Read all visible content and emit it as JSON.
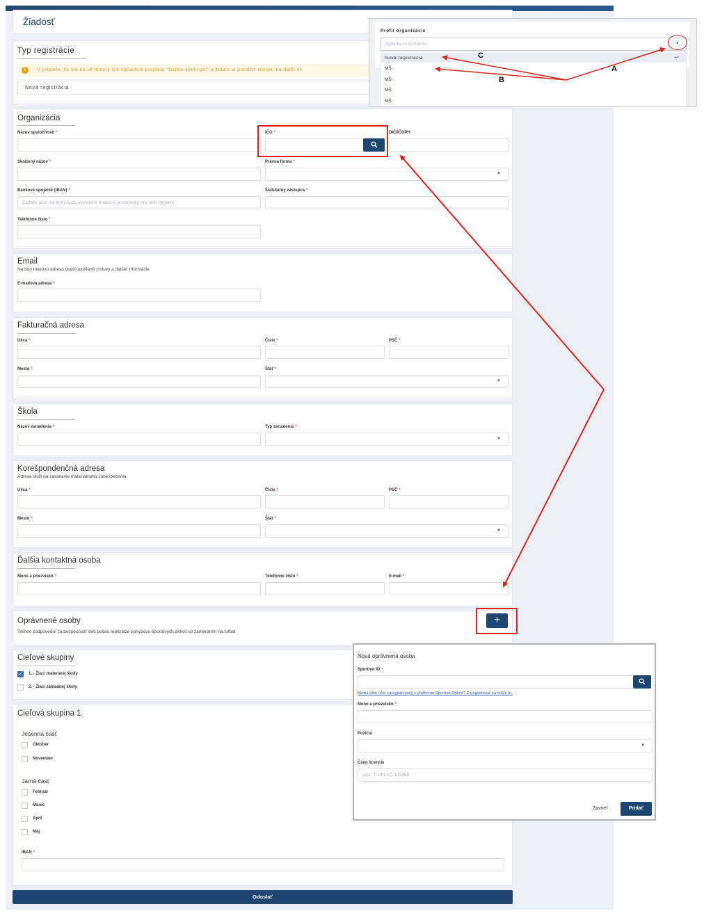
{
  "page": {
    "title": "Žiadosť",
    "submit_label": "Odoslať"
  },
  "registration": {
    "title": "Typ registrácie",
    "warning": "V prípade, že ste sa už minulý rok zúčastnili projektu \"Dajme spolu gól\" a želáte si predĺžiť zmluvu na ďalší šk",
    "select_value": "Nová registrácia"
  },
  "organization": {
    "title": "Organizácia",
    "company_name_label": "Názov spoločnosti",
    "ico_label": "IČO",
    "dic_label": "DIČ/IČDPH",
    "short_name_label": "Skrátený názov",
    "legal_form_label": "Právna forma",
    "iban_label": "Bankové spojenie (IBAN)",
    "iban_placeholder": "Zadajte účet, na ktorý budú vyplatené finančné prostriedky pre účel projektu",
    "statutory_label": "Štatutárny zástupca",
    "phone_label": "Telefónne číslo"
  },
  "email": {
    "title": "Email",
    "subtitle": "Na túto mailovú adresu budú odoslané zmluvy a ďalšie informácie",
    "field_label": "E-mailová adresa"
  },
  "billing": {
    "title": "Fakturačná adresa",
    "street_label": "Ulica",
    "number_label": "Číslo",
    "zip_label": "PSČ",
    "city_label": "Mesto",
    "state_label": "Štát"
  },
  "school": {
    "title": "Škola",
    "name_label": "Názov zariadenia",
    "type_label": "Typ zariadenia"
  },
  "correspondence": {
    "title": "Korešpondenčná adresa",
    "subtitle": "Adresa slúži na zasielanie materiálneho zabezpečenia",
    "street_label": "Ulica",
    "number_label": "Číslo",
    "zip_label": "PSČ",
    "city_label": "Mesto",
    "state_label": "Štát"
  },
  "contact": {
    "title": "Ďalšia kontaktná osoba",
    "name_label": "Meno a priezvisko",
    "phone_label": "Telefónne číslo",
    "email_label": "E-mail"
  },
  "authorized": {
    "title": "Oprávnené osoby",
    "subtitle": "Tréneri zodpovední za bezpečnosť detí počas realizácie pohybovo-športových aktivít so zameraním na futbal",
    "add_label": "+"
  },
  "target_groups": {
    "title": "Cieľové skupiny",
    "items": [
      {
        "label": "1. - Žiaci materskej školy",
        "checked": true
      },
      {
        "label": "2. - Žiaci základnej školy",
        "checked": false
      }
    ]
  },
  "target_group1": {
    "title": "Cieľová skupina 1",
    "autumn_title": "Jesenná časť",
    "autumn": [
      "Október",
      "November"
    ],
    "spring_title": "Jarná časť",
    "spring": [
      "Február",
      "Marec",
      "Apríl",
      "Máj"
    ],
    "iban_label": "IBAN"
  },
  "profile_popup": {
    "label": "Profil organizácie",
    "placeholder": "Vyberte zo zoznamu",
    "options": [
      "Nová registrácia",
      "MŠ",
      "MŠ",
      "MŠ",
      "MŠ"
    ],
    "enter_glyph": "↩",
    "marker_a": "A",
    "marker_b": "B",
    "marker_c": "C"
  },
  "person_modal": {
    "title": "Nová oprávnená osoba",
    "sportnet_label": "Sportnet ID",
    "register_link": "Nemá ešte účet zaregistrovaný v platforme Sportnet.Online? Zaregistrovať sa môže tu.",
    "name_label": "Meno a priezvisko",
    "position_label": "Pozícia",
    "license_label": "Číslo licencie",
    "license_placeholder": "vzor: T-UEFAC-123456",
    "close_label": "Zavrieť",
    "add_label": "Pridať"
  },
  "colors": {
    "primary": "#1d4673",
    "annotation_red": "#e32219",
    "warning_bg": "#fdf6e3",
    "warning_icon": "#e8a317"
  }
}
